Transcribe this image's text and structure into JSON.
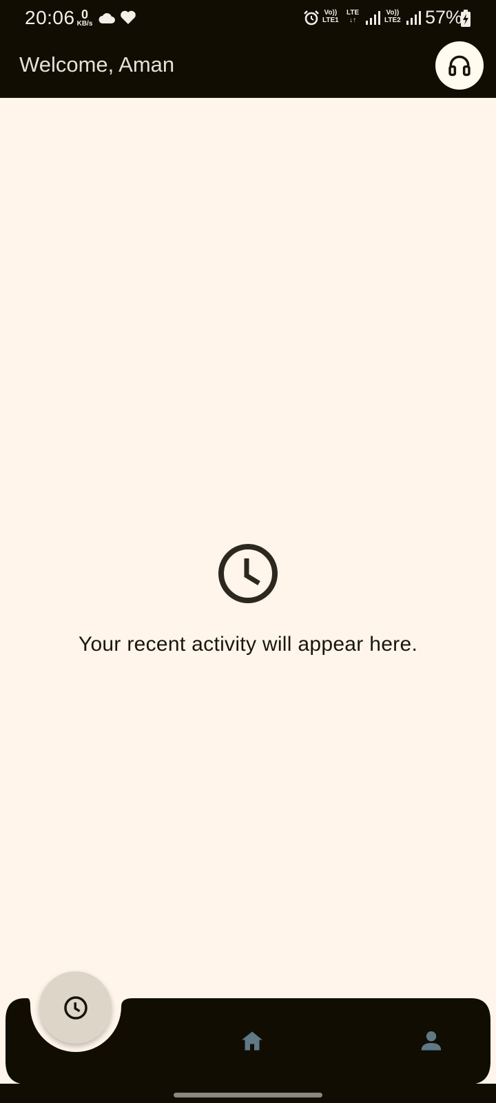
{
  "status_bar": {
    "time": "20:06",
    "net_speed_value": "0",
    "net_speed_unit": "KB/s",
    "sim1_top": "Vo))",
    "sim1_bottom": "LTE1",
    "data_top": "LTE",
    "data_bottom": "↓↑",
    "sim2_top": "Vo))",
    "sim2_bottom": "LTE2",
    "battery": "57%",
    "icons": [
      "cloud-icon",
      "heart-icon",
      "alarm-icon",
      "signal-icon",
      "battery-charging-icon"
    ]
  },
  "app_bar": {
    "title": "Welcome, Aman",
    "action_icon": "headphones-icon"
  },
  "empty_state": {
    "icon": "clock-icon",
    "message": "Your recent activity will appear here."
  },
  "bottom_nav": {
    "items": [
      {
        "icon": "clock-icon",
        "active": true
      },
      {
        "icon": "home-icon",
        "active": false
      },
      {
        "icon": "person-icon",
        "active": false
      }
    ]
  },
  "colors": {
    "background": "#fff5eb",
    "bar": "#110d03",
    "fab": "#ddd5c8",
    "nav_icon": "#5f7a86"
  }
}
